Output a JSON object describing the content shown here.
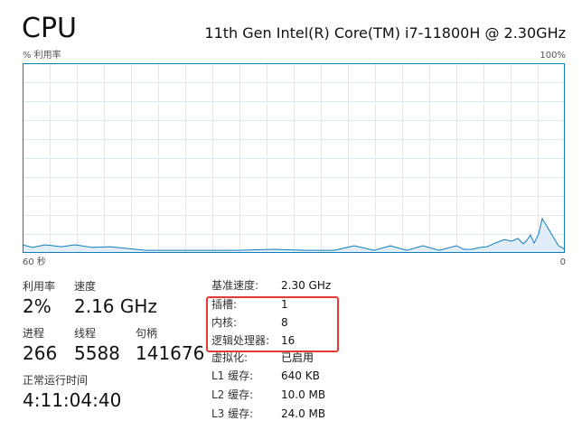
{
  "header": {
    "title": "CPU",
    "cpu_model": "11th Gen Intel(R) Core(TM) i7-11800H @ 2.30GHz"
  },
  "graph": {
    "y_label": "% 利用率",
    "y_max_label": "100%",
    "x_left_label": "60 秒",
    "x_right_label": "0",
    "line_color": "#117dbb",
    "fill_color": "#d9eaf7",
    "grid_color": "#d9eaf7",
    "border_color": "#117dbb"
  },
  "chart_data": {
    "type": "area",
    "ylim": [
      0,
      100
    ],
    "xlim": [
      60,
      0
    ],
    "x": [
      60,
      58.9,
      57.5,
      55.7,
      54.2,
      52.3,
      50.3,
      48.5,
      46.3,
      43.8,
      40.5,
      36.1,
      32.3,
      28.5,
      25.5,
      23.3,
      21.1,
      19.3,
      17.5,
      15.7,
      13.9,
      12,
      11.2,
      10.3,
      9.4,
      8.6,
      7.7,
      6.7,
      5.9,
      5.2,
      4.6,
      4.2,
      3.8,
      3.4,
      2.9,
      2.5,
      0.7,
      0
    ],
    "values": [
      4.3,
      2.9,
      4.3,
      3.3,
      4.3,
      2.9,
      3.3,
      2.4,
      1.4,
      1.4,
      1.4,
      1.4,
      1.9,
      1.4,
      1.4,
      3.8,
      1.4,
      3.8,
      1.4,
      3.8,
      1.4,
      3.8,
      1.9,
      1.9,
      2.9,
      3.3,
      5.2,
      7.1,
      6.2,
      7.6,
      4.8,
      6.7,
      9.5,
      5.2,
      10.0,
      18.1,
      3.8,
      1.9
    ]
  },
  "stats": {
    "utilization": {
      "label": "利用率",
      "value": "2%"
    },
    "speed": {
      "label": "速度",
      "value": "2.16 GHz"
    },
    "processes": {
      "label": "进程",
      "value": "266"
    },
    "threads": {
      "label": "线程",
      "value": "5588"
    },
    "handles": {
      "label": "句柄",
      "value": "141676"
    },
    "uptime": {
      "label": "正常运行时间",
      "value": "4:11:04:40"
    }
  },
  "info": [
    {
      "key": "基准速度:",
      "value": "2.30 GHz"
    },
    {
      "key": "插槽:",
      "value": "1"
    },
    {
      "key": "内核:",
      "value": "8"
    },
    {
      "key": "逻辑处理器:",
      "value": "16"
    },
    {
      "key": "虚拟化:",
      "value": "已启用"
    },
    {
      "key": "L1 缓存:",
      "value": "640 KB"
    },
    {
      "key": "L2 缓存:",
      "value": "10.0 MB"
    },
    {
      "key": "L3 缓存:",
      "value": "24.0 MB"
    }
  ],
  "highlight": {
    "color": "#e53935"
  }
}
